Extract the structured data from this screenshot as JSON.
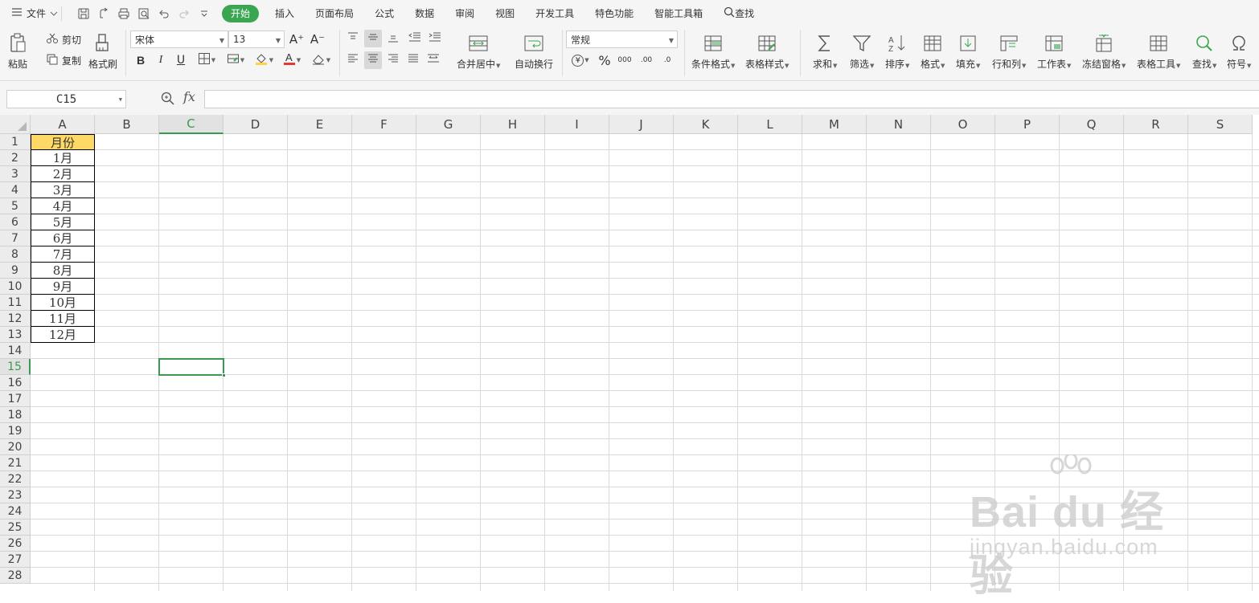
{
  "menubar": {
    "file_label": "文件",
    "tabs": [
      "开始",
      "插入",
      "页面布局",
      "公式",
      "数据",
      "审阅",
      "视图",
      "开发工具",
      "特色功能",
      "智能工具箱"
    ],
    "search_label": "查找"
  },
  "ribbon": {
    "paste": "粘贴",
    "cut": "剪切",
    "copy": "复制",
    "format_painter": "格式刷",
    "font_name": "宋体",
    "font_size": "13",
    "grow_font": "A⁺",
    "shrink_font": "A⁻",
    "bold": "B",
    "italic": "I",
    "underline": "U",
    "merge_center": "合并居中",
    "wrap_text": "自动换行",
    "number_format": "常规",
    "currency": "¥",
    "percent": "%",
    "thousands": "000",
    "inc_decimal": ".00",
    "dec_decimal": ".0",
    "conditional_format": "条件格式",
    "table_style": "表格样式",
    "sum": "求和",
    "filter": "筛选",
    "sort": "排序",
    "format": "格式",
    "fill": "填充",
    "rows_cols": "行和列",
    "worksheet": "工作表",
    "freeze_panes": "冻结窗格",
    "table_tools": "表格工具",
    "find": "查找",
    "symbol": "符号"
  },
  "formula": {
    "name_box": "C15",
    "fx": "fx",
    "value": ""
  },
  "sheet": {
    "columns": [
      "A",
      "B",
      "C",
      "D",
      "E",
      "F",
      "G",
      "H",
      "I",
      "J",
      "K",
      "L",
      "M",
      "N",
      "O",
      "P",
      "Q",
      "R",
      "S"
    ],
    "rows": [
      "1",
      "2",
      "3",
      "4",
      "5",
      "6",
      "7",
      "8",
      "9",
      "10",
      "11",
      "12",
      "13",
      "14",
      "15",
      "16",
      "17",
      "18",
      "19",
      "20",
      "21",
      "22",
      "23",
      "24",
      "25",
      "26",
      "27",
      "28"
    ],
    "selected_column": "C",
    "selected_row": "15",
    "column_a": [
      "月份",
      "1月",
      "2月",
      "3月",
      "4月",
      "5月",
      "6月",
      "7月",
      "8月",
      "9月",
      "10月",
      "11月",
      "12月"
    ]
  },
  "watermark": {
    "brand": "Bai du 经验",
    "url": "jingyan.baidu.com"
  }
}
